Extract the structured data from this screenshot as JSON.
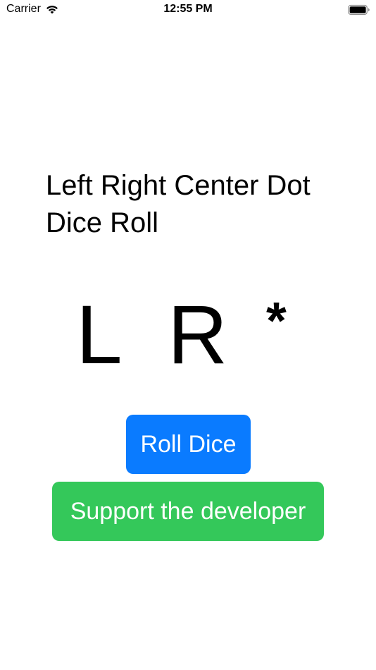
{
  "status_bar": {
    "carrier": "Carrier",
    "time": "12:55 PM",
    "wifi_icon": "wifi-icon",
    "battery_icon": "battery-icon"
  },
  "app": {
    "title": "Left Right Center Dot Dice Roll",
    "dice": [
      "L",
      "R",
      "*"
    ],
    "roll_button_label": "Roll Dice",
    "support_button_label": "Support the developer"
  },
  "colors": {
    "roll_button": "#0a7bff",
    "support_button": "#34c85a",
    "background": "#ffffff",
    "text": "#000000"
  }
}
